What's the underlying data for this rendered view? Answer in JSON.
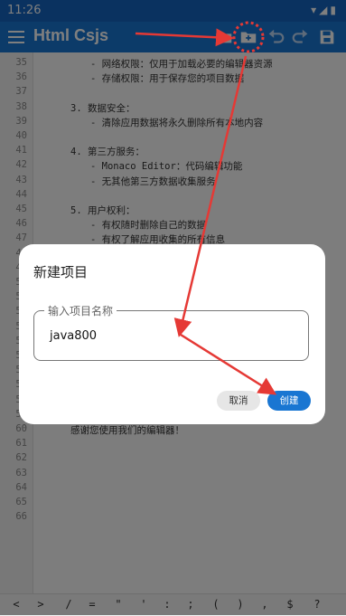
{
  "status_bar": {
    "time": "11:26"
  },
  "app_bar": {
    "title": "Html Csjs",
    "icons": [
      "menu-icon",
      "folder-icon",
      "new-folder-icon",
      "undo-icon",
      "redo-icon",
      "save-icon"
    ]
  },
  "editor": {
    "line_numbers": [
      "35",
      "36",
      "37",
      "38",
      "39",
      "40",
      "41",
      "42",
      "43",
      "44",
      "45",
      "46",
      "47",
      "48",
      "49",
      "50",
      "51",
      "52",
      "53",
      "54",
      "55",
      "56",
      "57",
      "58",
      "59",
      "60",
      "61",
      "62",
      "63",
      "64",
      "65",
      "66"
    ],
    "visible_lines": [
      {
        "n": "35",
        "text": "- 网络权限：仅用于加载必要的编辑器资源"
      },
      {
        "n": "36",
        "text": "- 存储权限：用于保存您的项目数据"
      },
      {
        "n": "38",
        "text": "3. 数据安全："
      },
      {
        "n": "39",
        "text": "- 清除应用数据将永久删除所有本地内容"
      },
      {
        "n": "41",
        "text": "4. 第三方服务："
      },
      {
        "n": "42",
        "text": "- Monaco Editor：代码编辑功能"
      },
      {
        "n": "43",
        "text": "- 无其他第三方数据收集服务"
      },
      {
        "n": "45",
        "text": "5. 用户权利："
      },
      {
        "n": "46",
        "text": "- 有权随时删除自己的数据"
      },
      {
        "n": "47",
        "text": "- 有权了解应用收集的所有信息"
      },
      {
        "n": "60",
        "text": "感谢您使用我们的编辑器！"
      }
    ]
  },
  "dialog": {
    "title": "新建项目",
    "field_label": "输入项目名称",
    "field_value": "java800",
    "cancel_label": "取消",
    "create_label": "创建"
  },
  "symbol_bar": [
    "<",
    ">",
    "/",
    "=",
    "\"",
    "'",
    ":",
    ";",
    "(",
    ")",
    ",",
    "$",
    "?"
  ],
  "colors": {
    "app_bar": "#1976d2",
    "status_bar": "#1565c0",
    "annotation": "#e53935",
    "primary_button": "#1976d2"
  }
}
